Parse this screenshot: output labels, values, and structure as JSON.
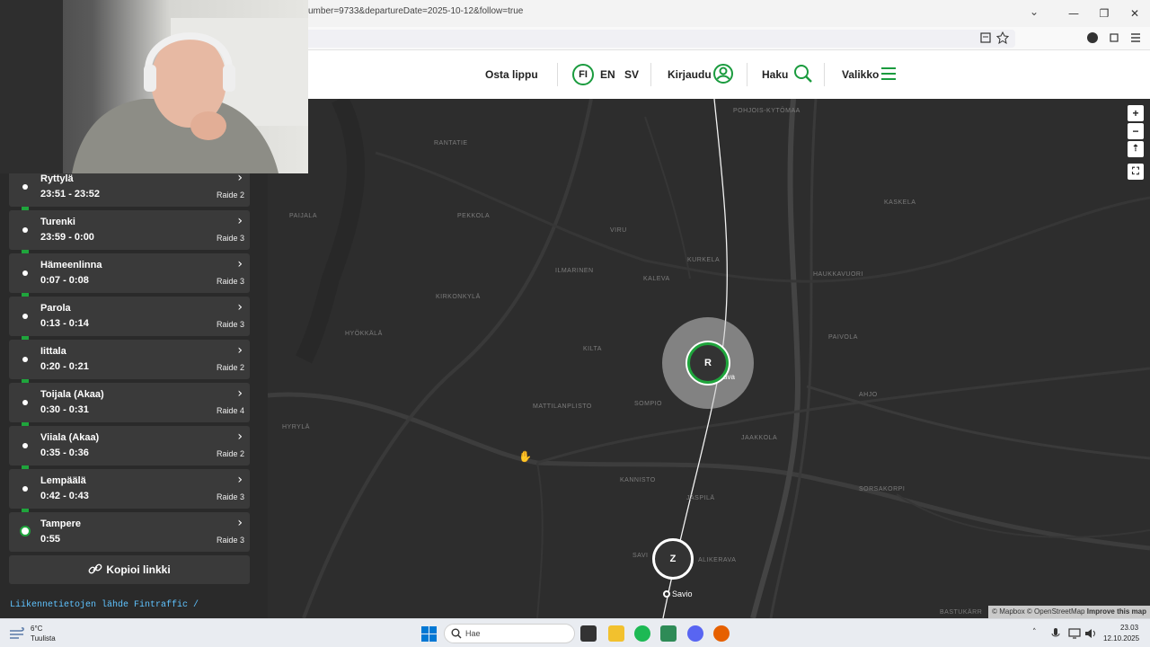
{
  "browser": {
    "url": "umber=9733&departureDate=2025-10-12&follow=true",
    "window_controls": {
      "dropdown": "⌄",
      "minimize": "—",
      "restore": "❐",
      "close": "✕"
    }
  },
  "header": {
    "buy_ticket": "Osta lippu",
    "languages": [
      "FI",
      "EN",
      "SV"
    ],
    "login": "Kirjaudu",
    "search": "Haku",
    "menu": "Valikko"
  },
  "stops": [
    {
      "name": "Ryttylä",
      "time": "23:51 - 23:52",
      "track": "Raide 2"
    },
    {
      "name": "Turenki",
      "time": "23:59 - 0:00",
      "track": "Raide 3"
    },
    {
      "name": "Hämeenlinna",
      "time": "0:07 - 0:08",
      "track": "Raide 3"
    },
    {
      "name": "Parola",
      "time": "0:13 - 0:14",
      "track": "Raide 3"
    },
    {
      "name": "Iittala",
      "time": "0:20 - 0:21",
      "track": "Raide 2"
    },
    {
      "name": "Toijala (Akaa)",
      "time": "0:30 - 0:31",
      "track": "Raide 4"
    },
    {
      "name": "Viiala (Akaa)",
      "time": "0:35 - 0:36",
      "track": "Raide 2"
    },
    {
      "name": "Lempäälä",
      "time": "0:42 - 0:43",
      "track": "Raide 3"
    },
    {
      "name": "Tampere",
      "time": "0:55",
      "track": "Raide 3"
    }
  ],
  "copy_link": "Kopioi linkki",
  "source_text": "Liikennetietojen lähde Fintraffic /",
  "map": {
    "places": [
      "POHJOIS-KYTÖMAA",
      "RANTATIE",
      "KASKELA",
      "PAIJALA",
      "PEKKOLA",
      "VIRU",
      "ILMARINEN",
      "KURKELA",
      "KALEVA",
      "HAUKKAVUORI",
      "KIRKONKYLÄ",
      "HYÖKKÄLÄ",
      "KILTA",
      "PAIVOLA",
      "AHJO",
      "MATTILANPLISTO",
      "SOMPIO",
      "HYRYLÄ",
      "JAAKKOLA",
      "KANNISTO",
      "JÄSPILÄ",
      "SORSAKORPI",
      "SAVI",
      "ALIKERAVA",
      "BASTUKÄRR"
    ],
    "marker_r": "R",
    "marker_z": "Z",
    "station_partial": "ava",
    "savio": "Savio",
    "controls": {
      "zoom_in": "+",
      "zoom_out": "−",
      "compass": "⇡",
      "fullscreen": "⛶"
    },
    "attribution_main": "© Mapbox © OpenStreetMap",
    "attribution_link": "Improve this map"
  },
  "taskbar": {
    "temp": "6°C",
    "weather": "Tuulista",
    "search": "Hae",
    "time": "23.03",
    "date": "12.10.2025"
  }
}
